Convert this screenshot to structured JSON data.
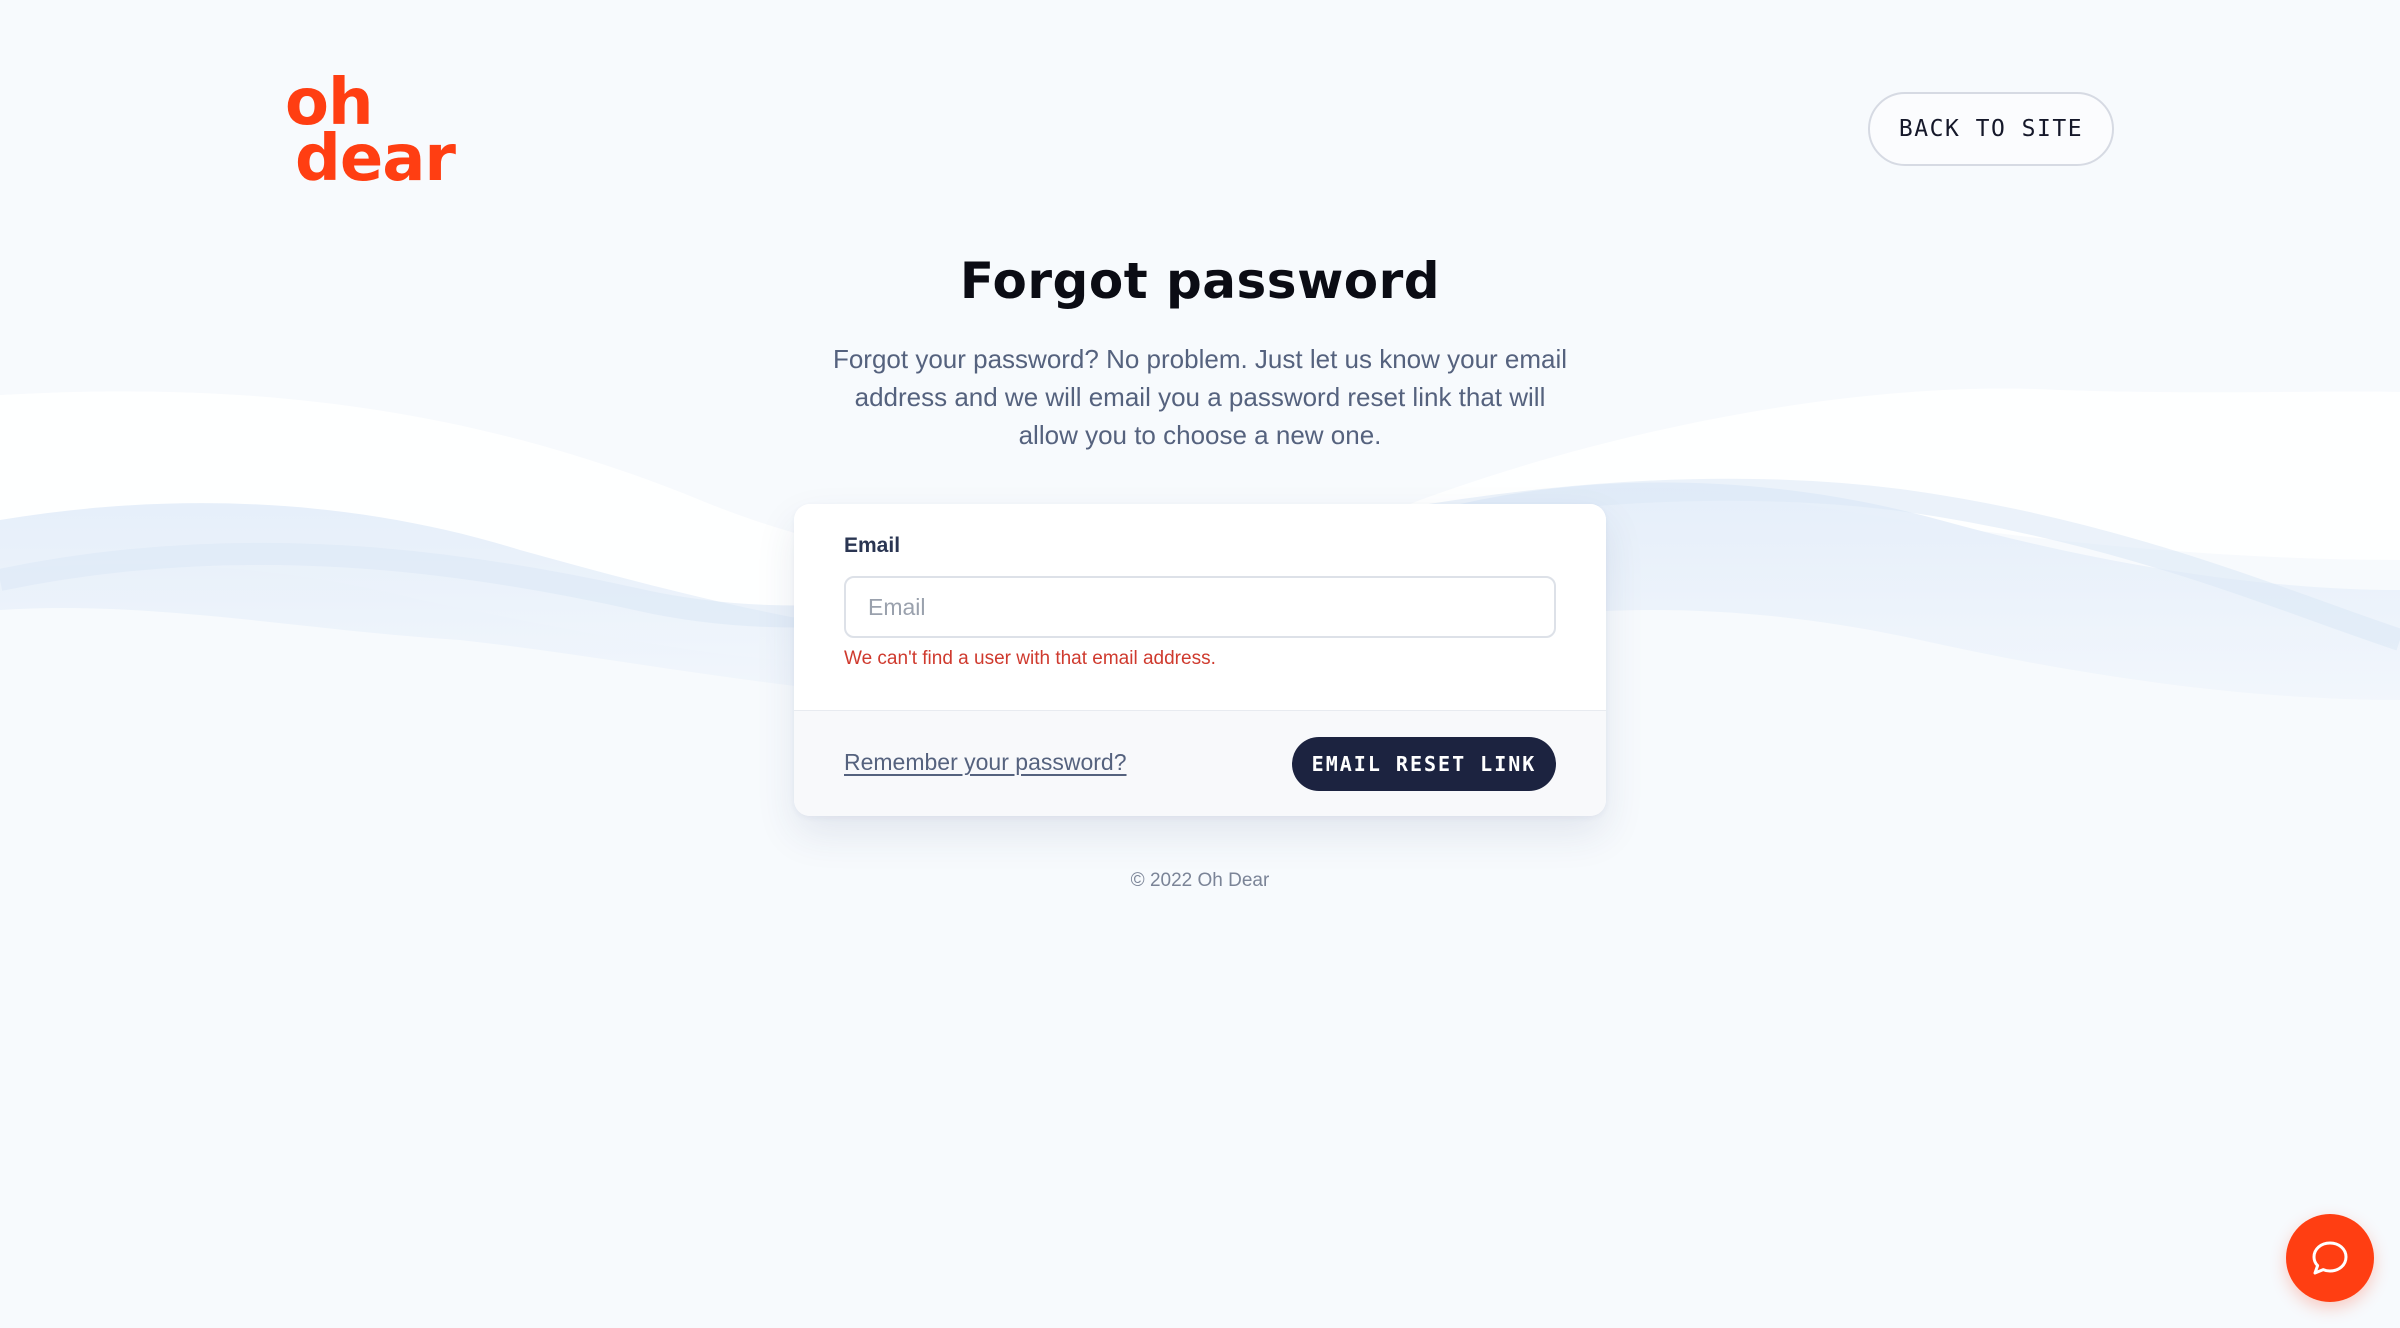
{
  "brand": {
    "logo_line1": "oh",
    "logo_line2": "dear",
    "logo_icon": "oh-dear-logo",
    "accent_color": "#ff3e12"
  },
  "header": {
    "back_label": "BACK TO SITE"
  },
  "main": {
    "title": "Forgot password",
    "intro": "Forgot your password? No problem. Just let us know your email address and we will email you a password reset link that will allow you to choose a new one."
  },
  "form": {
    "email_label": "Email",
    "email_placeholder": "Email",
    "email_value": "",
    "error": "We can't find a user with that email address.",
    "remember_link": "Remember your password?",
    "submit_label": "EMAIL RESET LINK",
    "button_color": "#1c2340",
    "error_color": "#cf3a2e"
  },
  "footer": {
    "copyright": "© 2022 Oh Dear"
  },
  "chat": {
    "icon": "chat-bubble-icon"
  }
}
